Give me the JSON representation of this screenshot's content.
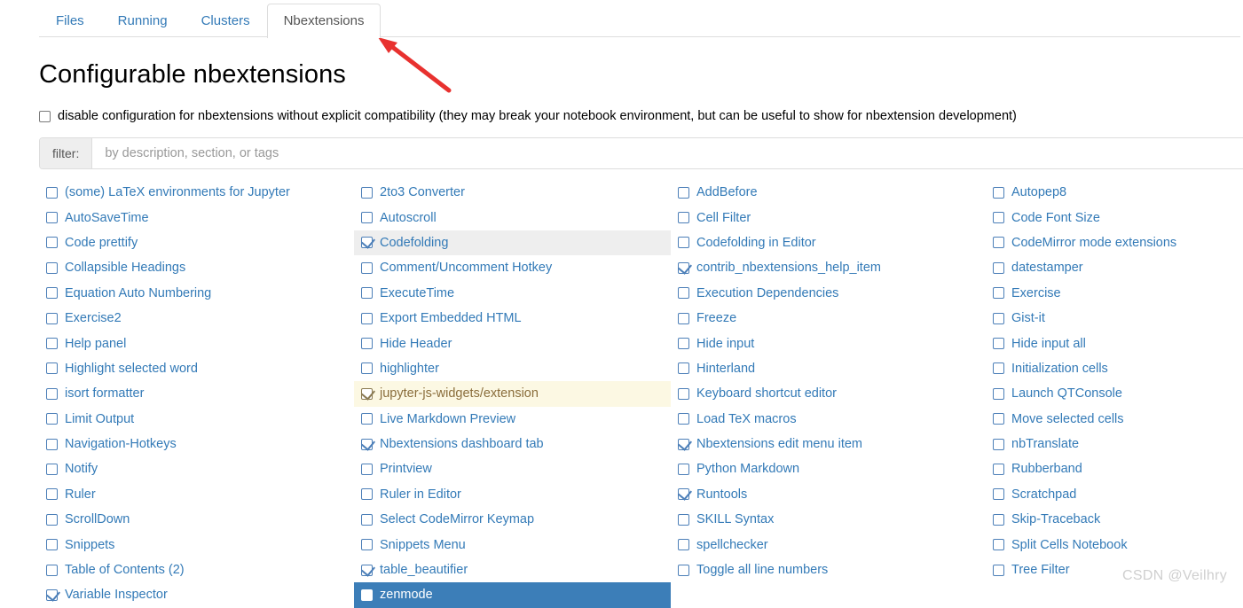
{
  "tabs": [
    {
      "label": "Files",
      "active": false
    },
    {
      "label": "Running",
      "active": false
    },
    {
      "label": "Clusters",
      "active": false
    },
    {
      "label": "Nbextensions",
      "active": true
    }
  ],
  "page": {
    "title": "Configurable nbextensions",
    "disable_config_label": "disable configuration for nbextensions without explicit compatibility (they may break your notebook environment, but can be useful to show for nbextension development)",
    "disable_config_checked": false
  },
  "filter": {
    "addon_label": "filter:",
    "placeholder": "by description, section, or tags",
    "value": ""
  },
  "watermark": "CSDN @Veilhry",
  "columns": [
    {
      "items": [
        {
          "label": "(some) LaTeX environments for Jupyter",
          "checked": false,
          "state": "normal"
        },
        {
          "label": "AutoSaveTime",
          "checked": false,
          "state": "normal"
        },
        {
          "label": "Code prettify",
          "checked": false,
          "state": "normal"
        },
        {
          "label": "Collapsible Headings",
          "checked": false,
          "state": "normal"
        },
        {
          "label": "Equation Auto Numbering",
          "checked": false,
          "state": "normal"
        },
        {
          "label": "Exercise2",
          "checked": false,
          "state": "normal"
        },
        {
          "label": "Help panel",
          "checked": false,
          "state": "normal"
        },
        {
          "label": "Highlight selected word",
          "checked": false,
          "state": "normal"
        },
        {
          "label": "isort formatter",
          "checked": false,
          "state": "normal"
        },
        {
          "label": "Limit Output",
          "checked": false,
          "state": "normal"
        },
        {
          "label": "Navigation-Hotkeys",
          "checked": false,
          "state": "normal"
        },
        {
          "label": "Notify",
          "checked": false,
          "state": "normal"
        },
        {
          "label": "Ruler",
          "checked": false,
          "state": "normal"
        },
        {
          "label": "ScrollDown",
          "checked": false,
          "state": "normal"
        },
        {
          "label": "Snippets",
          "checked": false,
          "state": "normal"
        },
        {
          "label": "Table of Contents (2)",
          "checked": false,
          "state": "normal"
        },
        {
          "label": "Variable Inspector",
          "checked": true,
          "state": "normal"
        }
      ]
    },
    {
      "items": [
        {
          "label": "2to3 Converter",
          "checked": false,
          "state": "normal"
        },
        {
          "label": "Autoscroll",
          "checked": false,
          "state": "normal"
        },
        {
          "label": "Codefolding",
          "checked": true,
          "state": "hover"
        },
        {
          "label": "Comment/Uncomment Hotkey",
          "checked": false,
          "state": "normal"
        },
        {
          "label": "ExecuteTime",
          "checked": false,
          "state": "normal"
        },
        {
          "label": "Export Embedded HTML",
          "checked": false,
          "state": "normal"
        },
        {
          "label": "Hide Header",
          "checked": false,
          "state": "normal"
        },
        {
          "label": "highlighter",
          "checked": false,
          "state": "normal"
        },
        {
          "label": "jupyter-js-widgets/extension",
          "checked": true,
          "state": "warn"
        },
        {
          "label": "Live Markdown Preview",
          "checked": false,
          "state": "normal"
        },
        {
          "label": "Nbextensions dashboard tab",
          "checked": true,
          "state": "normal"
        },
        {
          "label": "Printview",
          "checked": false,
          "state": "normal"
        },
        {
          "label": "Ruler in Editor",
          "checked": false,
          "state": "normal"
        },
        {
          "label": "Select CodeMirror Keymap",
          "checked": false,
          "state": "normal"
        },
        {
          "label": "Snippets Menu",
          "checked": false,
          "state": "normal"
        },
        {
          "label": "table_beautifier",
          "checked": true,
          "state": "normal"
        },
        {
          "label": "zenmode",
          "checked": false,
          "state": "selected"
        }
      ]
    },
    {
      "items": [
        {
          "label": "AddBefore",
          "checked": false,
          "state": "normal"
        },
        {
          "label": "Cell Filter",
          "checked": false,
          "state": "normal"
        },
        {
          "label": "Codefolding in Editor",
          "checked": false,
          "state": "normal"
        },
        {
          "label": "contrib_nbextensions_help_item",
          "checked": true,
          "state": "normal"
        },
        {
          "label": "Execution Dependencies",
          "checked": false,
          "state": "normal"
        },
        {
          "label": "Freeze",
          "checked": false,
          "state": "normal"
        },
        {
          "label": "Hide input",
          "checked": false,
          "state": "normal"
        },
        {
          "label": "Hinterland",
          "checked": false,
          "state": "normal"
        },
        {
          "label": "Keyboard shortcut editor",
          "checked": false,
          "state": "normal"
        },
        {
          "label": "Load TeX macros",
          "checked": false,
          "state": "normal"
        },
        {
          "label": "Nbextensions edit menu item",
          "checked": true,
          "state": "normal"
        },
        {
          "label": "Python Markdown",
          "checked": false,
          "state": "normal"
        },
        {
          "label": "Runtools",
          "checked": true,
          "state": "normal"
        },
        {
          "label": "SKILL Syntax",
          "checked": false,
          "state": "normal"
        },
        {
          "label": "spellchecker",
          "checked": false,
          "state": "normal"
        },
        {
          "label": "Toggle all line numbers",
          "checked": false,
          "state": "normal"
        }
      ]
    },
    {
      "items": [
        {
          "label": "Autopep8",
          "checked": false,
          "state": "normal"
        },
        {
          "label": "Code Font Size",
          "checked": false,
          "state": "normal"
        },
        {
          "label": "CodeMirror mode extensions",
          "checked": false,
          "state": "normal"
        },
        {
          "label": "datestamper",
          "checked": false,
          "state": "normal"
        },
        {
          "label": "Exercise",
          "checked": false,
          "state": "normal"
        },
        {
          "label": "Gist-it",
          "checked": false,
          "state": "normal"
        },
        {
          "label": "Hide input all",
          "checked": false,
          "state": "normal"
        },
        {
          "label": "Initialization cells",
          "checked": false,
          "state": "normal"
        },
        {
          "label": "Launch QTConsole",
          "checked": false,
          "state": "normal"
        },
        {
          "label": "Move selected cells",
          "checked": false,
          "state": "normal"
        },
        {
          "label": "nbTranslate",
          "checked": false,
          "state": "normal"
        },
        {
          "label": "Rubberband",
          "checked": false,
          "state": "normal"
        },
        {
          "label": "Scratchpad",
          "checked": false,
          "state": "normal"
        },
        {
          "label": "Skip-Traceback",
          "checked": false,
          "state": "normal"
        },
        {
          "label": "Split Cells Notebook",
          "checked": false,
          "state": "normal"
        },
        {
          "label": "Tree Filter",
          "checked": false,
          "state": "normal"
        }
      ]
    }
  ],
  "annotation": {
    "type": "red-arrow",
    "color": "#e8312f"
  }
}
